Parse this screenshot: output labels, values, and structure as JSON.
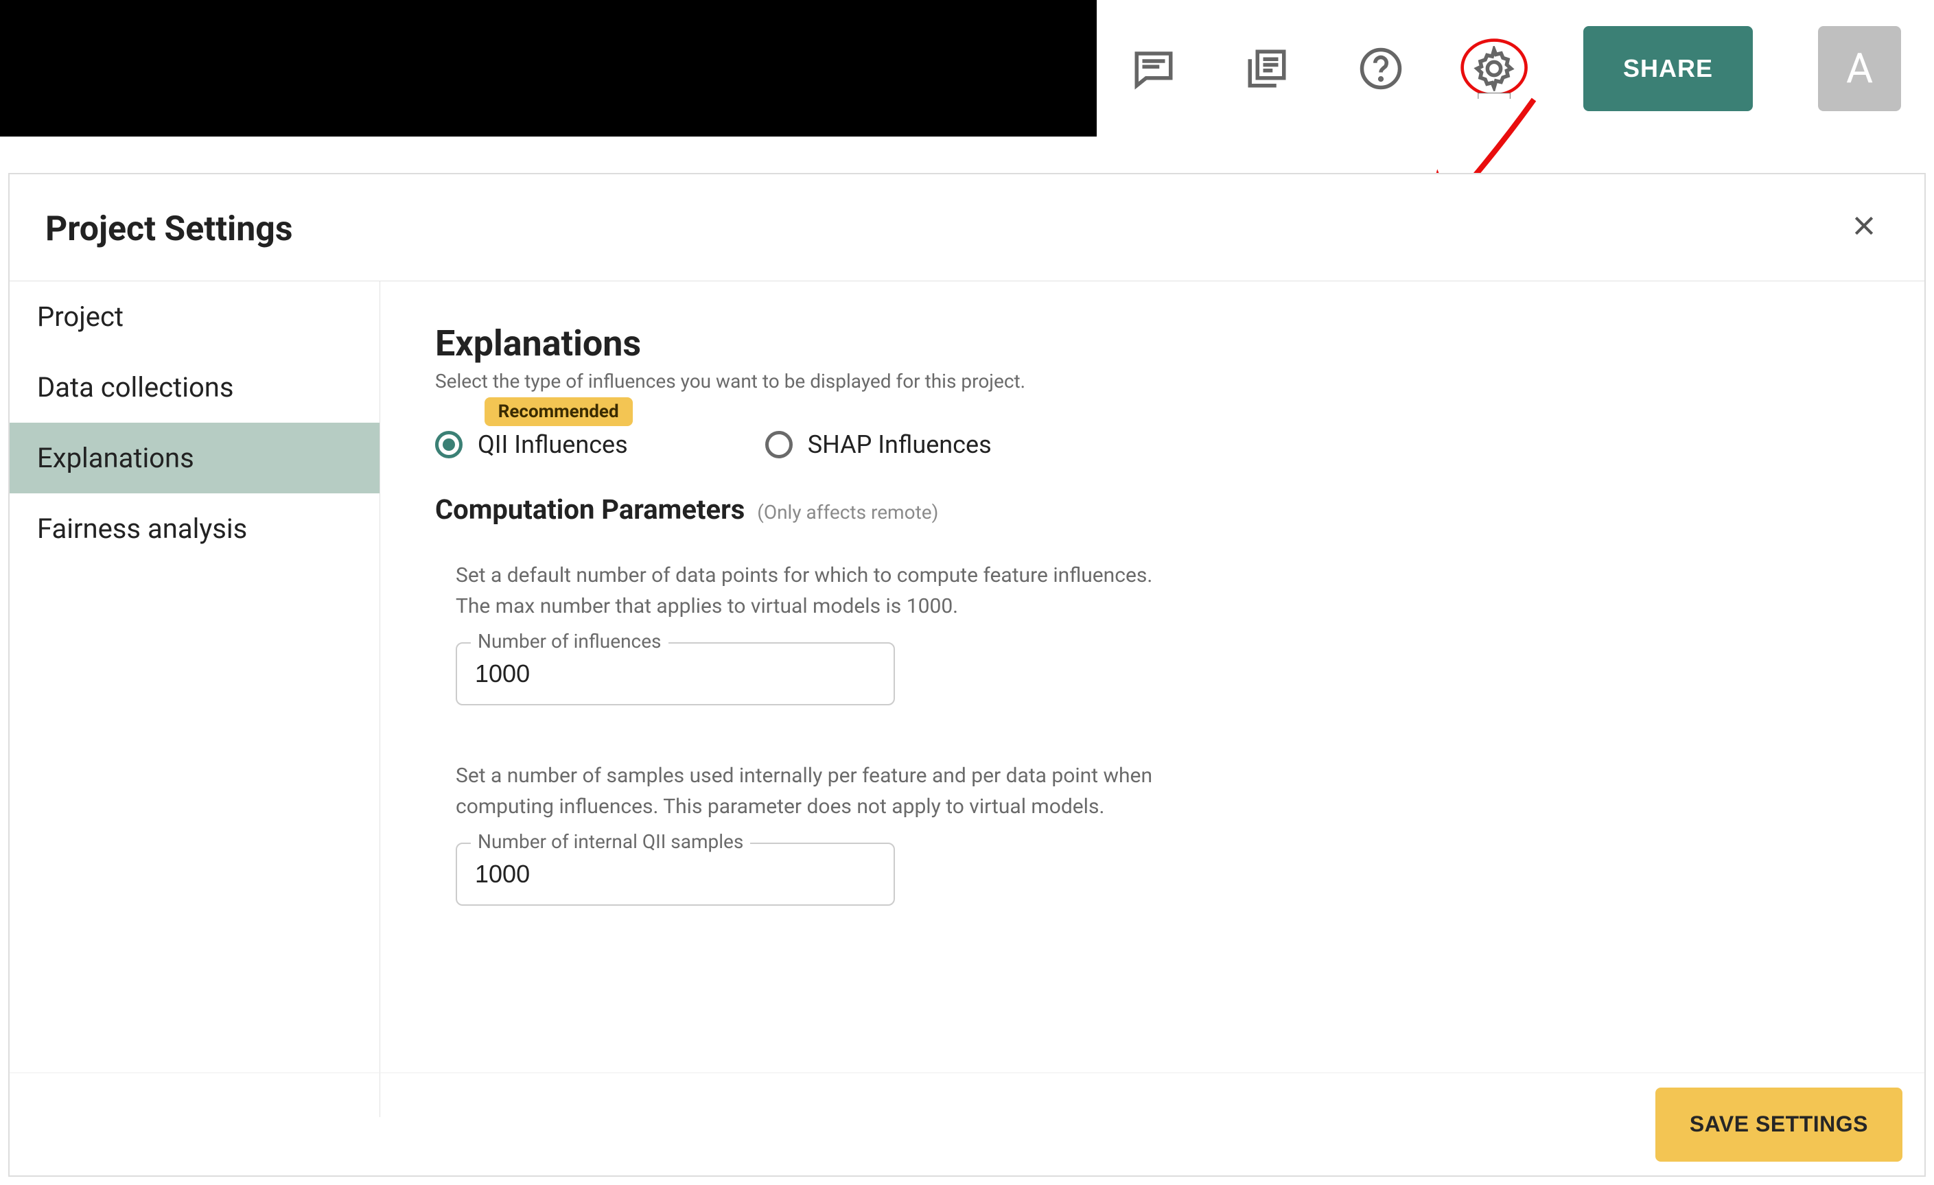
{
  "toolbar": {
    "share_label": "SHARE",
    "avatar_letter": "A"
  },
  "dialog": {
    "title": "Project Settings"
  },
  "sidebar": {
    "items": [
      "Project",
      "Data collections",
      "Explanations",
      "Fairness analysis"
    ],
    "active_index": 2
  },
  "explanations": {
    "heading": "Explanations",
    "subtitle": "Select the type of influences you want to be displayed for this project.",
    "badge_label": "Recommended",
    "options": {
      "qii": "QII Influences",
      "shap": "SHAP Influences",
      "selected": "qii"
    },
    "computation": {
      "heading": "Computation Parameters",
      "hint": "(Only affects remote)",
      "influences": {
        "description": "Set a default number of data points for which to compute feature influences. The max number that applies to virtual models is 1000.",
        "label": "Number of influences",
        "value": "1000"
      },
      "samples": {
        "description": "Set a number of samples used internally per feature and per data point when computing influences. This parameter does not apply to virtual models.",
        "label": "Number of internal QII samples",
        "value": "1000"
      }
    }
  },
  "footer": {
    "save_label": "SAVE SETTINGS"
  }
}
